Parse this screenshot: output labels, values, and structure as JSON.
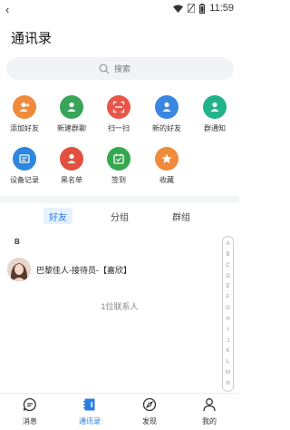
{
  "status_bar": {
    "back": "‹",
    "time": "11:59"
  },
  "header": {
    "title": "通讯录"
  },
  "search": {
    "placeholder": "搜索"
  },
  "quick_actions": [
    {
      "label": "添加好友",
      "color": "#f08a3c",
      "icon": "add-friend-icon"
    },
    {
      "label": "新建群聊",
      "color": "#3aa55a",
      "icon": "new-group-icon"
    },
    {
      "label": "扫一扫",
      "color": "#e8564a",
      "icon": "scan-icon"
    },
    {
      "label": "新的好友",
      "color": "#3b86e0",
      "icon": "new-friend-icon"
    },
    {
      "label": "群通知",
      "color": "#22b38a",
      "icon": "group-notice-icon"
    },
    {
      "label": "设备记录",
      "color": "#2f86de",
      "icon": "device-record-icon"
    },
    {
      "label": "黑名单",
      "color": "#e2503f",
      "icon": "blacklist-icon"
    },
    {
      "label": "签到",
      "color": "#35a84f",
      "icon": "checkin-icon"
    },
    {
      "label": "收藏",
      "color": "#f08a3c",
      "icon": "favorite-icon"
    }
  ],
  "tabs": [
    {
      "label": "好友",
      "active": true
    },
    {
      "label": "分组",
      "active": false
    },
    {
      "label": "群组",
      "active": false
    }
  ],
  "contacts": {
    "section_letter": "B",
    "items": [
      {
        "name": "巴黎佳人-接待员-【嘉欣】"
      }
    ],
    "count_text": "1位联系人"
  },
  "az_index": [
    "A",
    "B",
    "C",
    "D",
    "E",
    "F",
    "G",
    "H",
    "I",
    "J",
    "K",
    "L",
    "M",
    "N"
  ],
  "bottom_nav": [
    {
      "label": "消息",
      "icon": "message-icon",
      "active": false
    },
    {
      "label": "通讯录",
      "icon": "contacts-icon",
      "active": true
    },
    {
      "label": "发现",
      "icon": "compass-icon",
      "active": false
    },
    {
      "label": "我的",
      "icon": "profile-icon",
      "active": false
    }
  ],
  "colors": {
    "accent": "#2a7de1"
  }
}
